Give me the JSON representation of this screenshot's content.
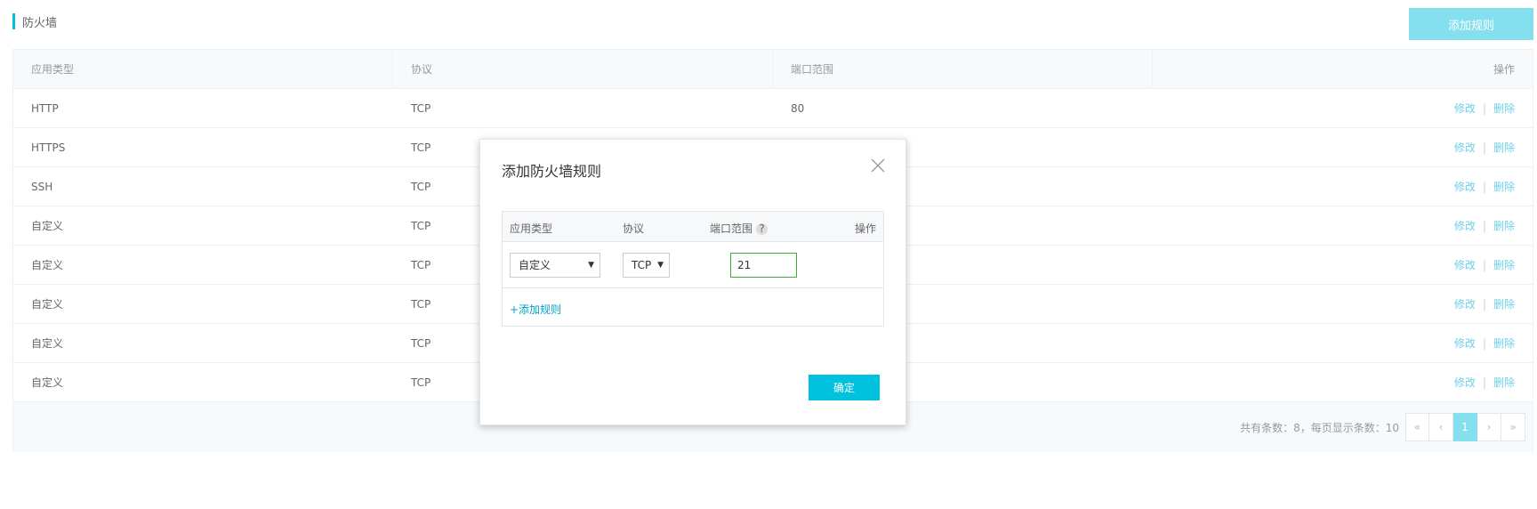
{
  "page": {
    "title": "防火墙",
    "add_rule_button": "添加规则"
  },
  "table": {
    "headers": [
      "应用类型",
      "协议",
      "端口范围",
      "操作"
    ],
    "rows": [
      {
        "app": "HTTP",
        "protocol": "TCP",
        "port": "80"
      },
      {
        "app": "HTTPS",
        "protocol": "TCP",
        "port": ""
      },
      {
        "app": "SSH",
        "protocol": "TCP",
        "port": ""
      },
      {
        "app": "自定义",
        "protocol": "TCP",
        "port": ""
      },
      {
        "app": "自定义",
        "protocol": "TCP",
        "port": ""
      },
      {
        "app": "自定义",
        "protocol": "TCP",
        "port": ""
      },
      {
        "app": "自定义",
        "protocol": "TCP",
        "port": ""
      },
      {
        "app": "自定义",
        "protocol": "TCP",
        "port": ""
      }
    ],
    "edit_label": "修改",
    "separator": "|",
    "delete_label": "删除"
  },
  "pagination": {
    "summary": "共有条数：8，每页显示条数：10",
    "first": "«",
    "prev": "‹",
    "current": "1",
    "next": "›",
    "last": "»"
  },
  "modal": {
    "title": "添加防火墙规则",
    "headers": {
      "app": "应用类型",
      "protocol": "协议",
      "port": "端口范围",
      "help": "?",
      "ops": "操作"
    },
    "app_select_value": "自定义",
    "protocol_select_value": "TCP",
    "port_value": "21",
    "add_rule_link": "+添加规则",
    "confirm_button": "确定"
  },
  "colors": {
    "accent": "#00c1de",
    "accent_light": "#84e0ef",
    "link": "#6fcfe6",
    "input_border": "#3cb034"
  },
  "icons": {
    "close": "close-icon",
    "dropdown": "caret-down-icon"
  }
}
